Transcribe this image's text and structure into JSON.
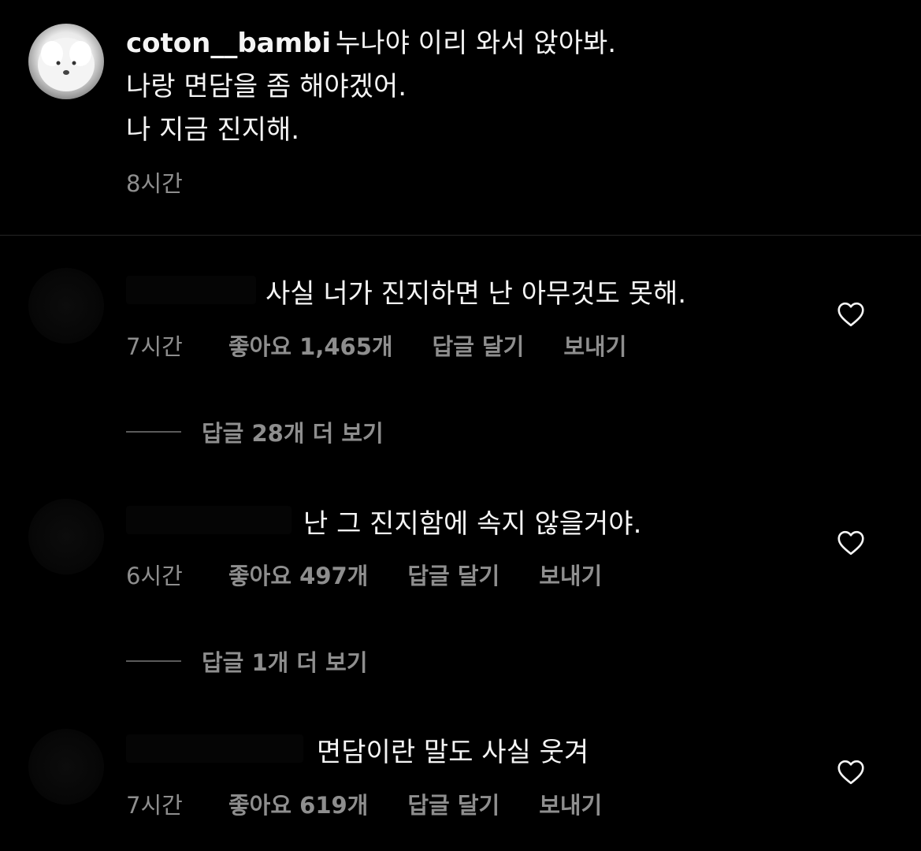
{
  "post": {
    "username": "coton__bambi",
    "line1": "누나야 이리 와서 앉아봐.",
    "line2": "나랑 면담을 좀 해야겠어.",
    "line3": "나 지금 진지해.",
    "time": "8시간"
  },
  "comments": [
    {
      "text": "사실 너가 진지하면 난 아무것도 못해.",
      "time": "7시간",
      "likes": "좋아요 1,465개",
      "reply_label": "답글 달기",
      "send_label": "보내기",
      "view_replies": "답글 28개 더 보기",
      "heart_icon": "heart-outline"
    },
    {
      "text": "난 그 진지함에 속지 않을거야.",
      "time": "6시간",
      "likes": "좋아요 497개",
      "reply_label": "답글 달기",
      "send_label": "보내기",
      "view_replies": "답글 1개 더 보기",
      "heart_icon": "heart-outline"
    },
    {
      "text": "면담이란 말도 사실 웃겨",
      "time": "7시간",
      "likes": "좋아요 619개",
      "reply_label": "답글 달기",
      "send_label": "보내기",
      "heart_icon": "heart-outline"
    }
  ],
  "colors": {
    "background": "#000000",
    "primary_text": "#f5f5f5",
    "secondary_text": "#8e8e8e",
    "divider": "#262626"
  }
}
